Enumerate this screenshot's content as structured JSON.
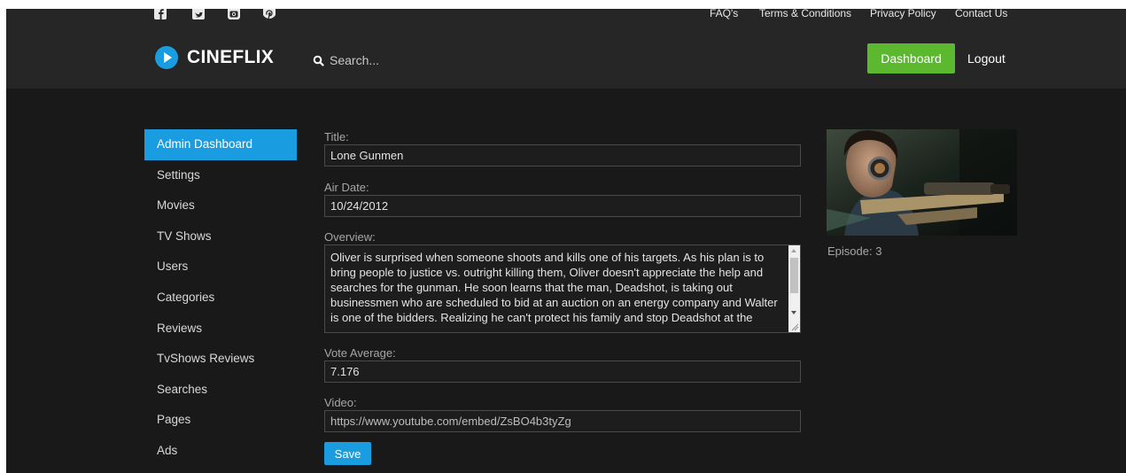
{
  "social": {
    "icons": [
      "facebook-icon",
      "twitter-icon",
      "instagram-icon",
      "pinterest-icon"
    ]
  },
  "top_links": {
    "faqs": "FAQ's",
    "terms": "Terms & Conditions",
    "privacy": "Privacy Policy",
    "contact": "Contact Us"
  },
  "header": {
    "brand": "CINEFLIX",
    "search_placeholder": "Search...",
    "dashboard_label": "Dashboard",
    "logout_label": "Logout"
  },
  "sidebar": {
    "items": [
      {
        "label": "Admin Dashboard",
        "active": true
      },
      {
        "label": "Settings"
      },
      {
        "label": "Movies"
      },
      {
        "label": "TV Shows"
      },
      {
        "label": "Users"
      },
      {
        "label": "Categories"
      },
      {
        "label": "Reviews"
      },
      {
        "label": "TvShows Reviews"
      },
      {
        "label": "Searches"
      },
      {
        "label": "Pages"
      },
      {
        "label": "Ads"
      }
    ]
  },
  "form": {
    "title_label": "Title:",
    "title_value": "Lone Gunmen",
    "air_date_label": "Air Date:",
    "air_date_value": "10/24/2012",
    "overview_label": "Overview:",
    "overview_value": "Oliver is surprised when someone shoots and kills one of his targets. As his plan is to bring people to justice vs. outright killing them, Oliver doesn't appreciate the help and searches for the gunman. He soon learns that the man, Deadshot, is taking out businessmen who are scheduled to bid at an auction on an energy company and Walter is one of the bidders. Realizing he can't protect his family and stop Deadshot at the",
    "vote_label": "Vote Average:",
    "vote_value": "7.176",
    "video_label": "Video:",
    "video_value": "https://www.youtube.com/embed/ZsBO4b3tyZg",
    "save_label": "Save"
  },
  "episode": {
    "label": "Episode: 3"
  },
  "colors": {
    "accent_blue": "#1a9ce0",
    "dashboard_green": "#5cb82e",
    "header_bg": "#262626",
    "page_bg": "#191919"
  }
}
